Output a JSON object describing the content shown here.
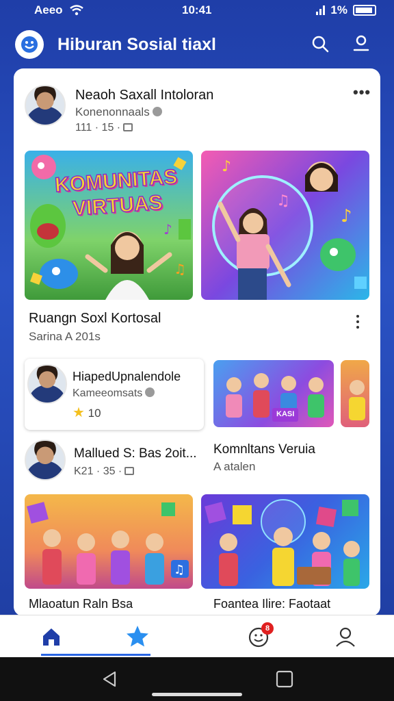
{
  "status_bar": {
    "carrier": "Aeeo",
    "time": "10:41",
    "battery": "1%"
  },
  "header": {
    "title": "Hiburan Sosial tiaxl"
  },
  "post1": {
    "name": "Neaoh Saxall Intoloran",
    "subtitle": "Konenonnaals",
    "meta": "111 · 15 ·"
  },
  "tile_overlay": {
    "line1": "KOMUNITAS",
    "line2": "VIRTUAS"
  },
  "section1": {
    "title": "Ruangn Soxl Kortosal",
    "subtitle": "Sarina  A 201s"
  },
  "inner_card": {
    "name": "HiapedUpnalendole",
    "subtitle": "Kameeomsats",
    "rating": "10"
  },
  "side_item": {
    "title": "Komnltans Veruia",
    "subtitle": "A atalen"
  },
  "post2": {
    "name": "Mallued S: Bas 2oit...",
    "meta": "K21 · 35 ·"
  },
  "banner_text": "KASI",
  "captions": {
    "left": "Mlaoatun Raln Bsa",
    "right": "Foantea Ilire: Faotaat"
  },
  "nav": {
    "badge": "8"
  },
  "colors": {
    "accent": "#2a66e4",
    "header_bg": "#1f3ea8",
    "badge": "#e02020"
  }
}
